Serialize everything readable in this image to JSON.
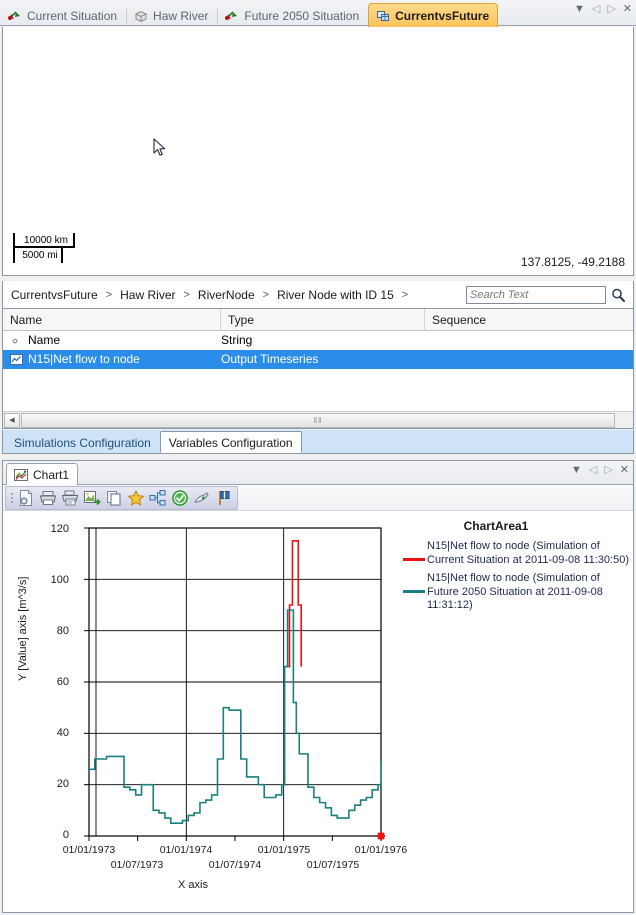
{
  "window": {
    "controls": [
      {
        "name": "dropdown-menu",
        "glyph": "▼"
      },
      {
        "name": "prev",
        "glyph": "◁"
      },
      {
        "name": "next",
        "glyph": "▷"
      },
      {
        "name": "close",
        "glyph": "✕"
      }
    ]
  },
  "document_tabs": [
    {
      "label": "Current Situation",
      "icon": "network-model-icon",
      "active": false
    },
    {
      "label": "Haw River",
      "icon": "box-model-icon",
      "active": false
    },
    {
      "label": "Future 2050 Situation",
      "icon": "network-model-icon",
      "active": false
    },
    {
      "label": "CurrentvsFuture",
      "icon": "comparison-icon",
      "active": true
    }
  ],
  "map": {
    "scale_km": "10000 km",
    "scale_mi": "5000 mi",
    "coordinates": "137.8125, -49.2188"
  },
  "breadcrumb": {
    "items": [
      "CurrentvsFuture",
      "Haw River",
      "RiverNode",
      "River Node with ID 15"
    ],
    "separator": ">",
    "trailing_separator": ">"
  },
  "search": {
    "placeholder": "Search Text",
    "value": "",
    "button_icon": "search-icon"
  },
  "grid": {
    "columns": [
      "Name",
      "Type",
      "Sequence"
    ],
    "rows": [
      {
        "icon": "property-dot-icon",
        "name": "Name",
        "type": "String",
        "sequence": "",
        "selected": false
      },
      {
        "icon": "timeseries-chart-icon",
        "name": "N15|Net flow to node",
        "type": "Output Timeseries",
        "sequence": "",
        "selected": true
      }
    ],
    "hscroll_grip": "‖‖"
  },
  "config_tabs": [
    {
      "label": "Simulations Configuration",
      "active": false
    },
    {
      "label": "Variables Configuration",
      "active": true
    }
  ],
  "chart_panel": {
    "tab_label": "Chart1",
    "tab_icon": "chart-icon",
    "toolbar_buttons": [
      {
        "name": "save-chart-button",
        "icon": "save-document-icon"
      },
      {
        "name": "print-button",
        "icon": "printer-icon"
      },
      {
        "name": "print-preview-button",
        "icon": "print-preview-icon"
      },
      {
        "name": "export-image-button",
        "icon": "export-image-icon"
      },
      {
        "name": "copy-button",
        "icon": "copy-pages-icon"
      },
      {
        "name": "favorite-button",
        "icon": "star-icon"
      },
      {
        "name": "organize-series-button",
        "icon": "hierarchy-icon"
      },
      {
        "name": "apply-button",
        "icon": "green-check-icon"
      },
      {
        "name": "edit-chart-button",
        "icon": "pencil-edit-icon"
      },
      {
        "name": "flag-button",
        "icon": "blue-flag-icon"
      }
    ],
    "controls": [
      {
        "name": "dropdown-menu",
        "glyph": "▼"
      },
      {
        "name": "prev",
        "glyph": "◁"
      },
      {
        "name": "next",
        "glyph": "▷"
      },
      {
        "name": "close",
        "glyph": "✕"
      }
    ]
  },
  "chart_data": {
    "type": "line",
    "title": "ChartArea1",
    "xlabel": "X axis",
    "ylabel": "Y [Value] axis [m^3/s]",
    "ylim": [
      0,
      120
    ],
    "yticks": [
      0,
      20,
      40,
      60,
      80,
      100,
      120
    ],
    "xtick_labels_row1": [
      "01/01/1973",
      "01/01/1974",
      "01/01/1975",
      "01/01/1976"
    ],
    "xtick_labels_row2": [
      "01/07/1973",
      "01/07/1974",
      "01/07/1975"
    ],
    "xlim": [
      "01/01/1973",
      "01/01/1976"
    ],
    "grid": true,
    "legend_position": "right",
    "colors": {
      "current": "#ee1111",
      "future": "#1a7f7f"
    },
    "end_marker": {
      "shape": "star",
      "color": "#ee1111",
      "x": "01/01/1976",
      "y": 0
    },
    "series": [
      {
        "name": "N15|Net flow to node (Simulation of Current Situation at 2011-09-08 11:30:50)",
        "color": "#ee1111",
        "x": [
          2.03,
          2.06,
          2.09,
          2.12,
          2.15,
          2.18
        ],
        "values": [
          66,
          90,
          115,
          115,
          90,
          66
        ]
      },
      {
        "name": "N15|Net flow to node (Simulation of Future 2050 Situation at 2011-09-08 11:31:12)",
        "color": "#1a7f7f",
        "x": [
          0.0,
          0.06,
          0.12,
          0.18,
          0.24,
          0.3,
          0.36,
          0.42,
          0.48,
          0.54,
          0.6,
          0.66,
          0.72,
          0.78,
          0.84,
          0.9,
          0.96,
          1.02,
          1.08,
          1.14,
          1.2,
          1.26,
          1.32,
          1.38,
          1.44,
          1.5,
          1.56,
          1.62,
          1.68,
          1.74,
          1.8,
          1.86,
          1.92,
          1.98,
          2.01,
          2.04,
          2.07,
          2.1,
          2.13,
          2.16,
          2.19,
          2.25,
          2.31,
          2.37,
          2.43,
          2.49,
          2.55,
          2.61,
          2.67,
          2.73,
          2.79,
          2.85,
          2.91,
          2.97,
          3.0
        ],
        "values": [
          26,
          30,
          30,
          31,
          31,
          31,
          19,
          18,
          16,
          20,
          20,
          10,
          9,
          7,
          5,
          5,
          6,
          8,
          9,
          13,
          14,
          16,
          30,
          50,
          49,
          49,
          30,
          23,
          23,
          20,
          15,
          15,
          16,
          20,
          66,
          88,
          88,
          52,
          40,
          32,
          32,
          19,
          15,
          13,
          11,
          8,
          7,
          7,
          10,
          12,
          14,
          15,
          18,
          20,
          29
        ]
      }
    ]
  }
}
